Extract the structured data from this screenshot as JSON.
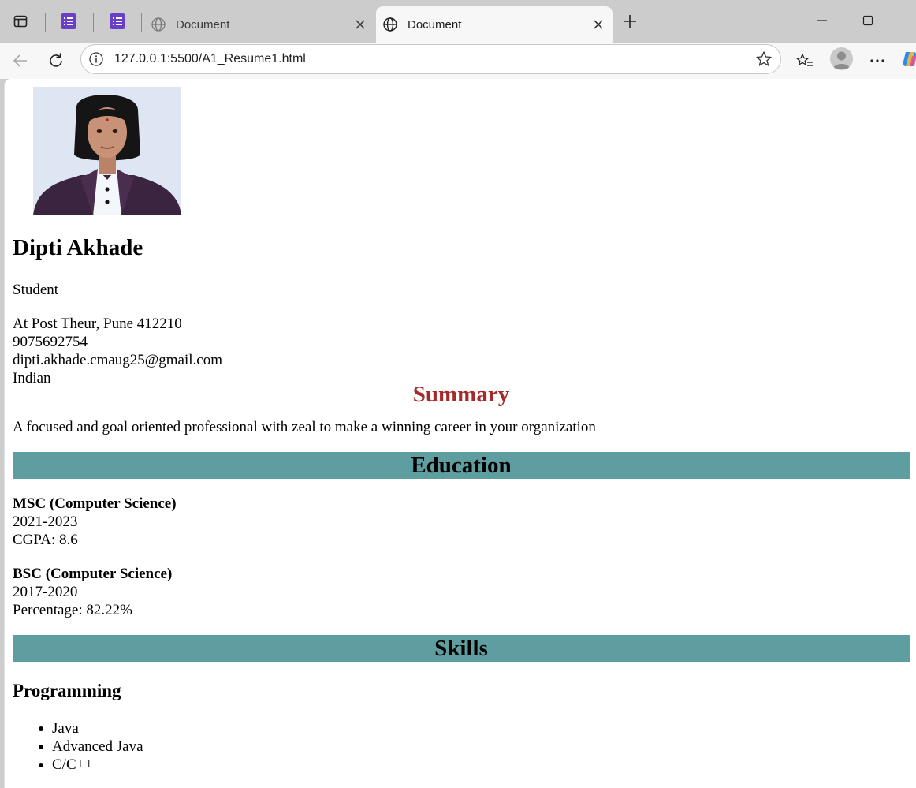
{
  "browser": {
    "tabs": [
      {
        "title": "Document",
        "active": false
      },
      {
        "title": "Document",
        "active": true
      }
    ],
    "url": "127.0.0.1:5500/A1_Resume1.html",
    "accent_color": "#6a3fc8"
  },
  "resume": {
    "photo_alt": "",
    "name": "Dipti Akhade",
    "role": "Student",
    "contact": {
      "address": "At Post Theur, Pune 412210",
      "phone": "9075692754",
      "email": "dipti.akhade.cmaug25@gmail.com",
      "nationality": "Indian"
    },
    "summary": {
      "heading": "Summary",
      "text": "A focused and goal oriented professional with zeal to make a winning career in your organization",
      "heading_color": "#a52a2a"
    },
    "education": {
      "heading": "Education",
      "band_color": "#5f9ea0",
      "items": [
        {
          "degree": "MSC (Computer Science)",
          "years": "2021-2023",
          "score": "CGPA: 8.6"
        },
        {
          "degree": "BSC (Computer Science)",
          "years": "2017-2020",
          "score": "Percentage: 82.22%"
        }
      ]
    },
    "skills": {
      "heading": "Skills",
      "programming": {
        "heading": "Programming",
        "items": [
          "Java",
          "Advanced Java",
          "C/C++"
        ]
      }
    }
  }
}
